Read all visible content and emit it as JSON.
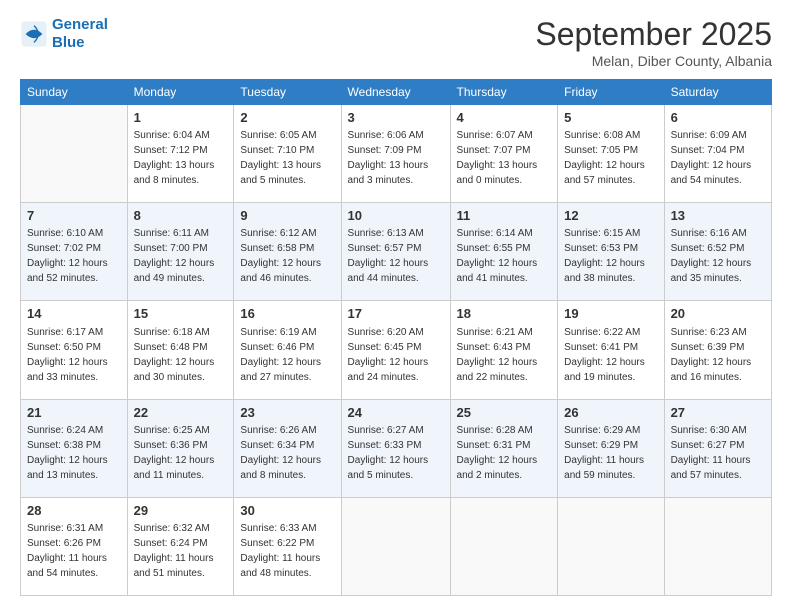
{
  "logo": {
    "line1": "General",
    "line2": "Blue"
  },
  "title": "September 2025",
  "subtitle": "Melan, Diber County, Albania",
  "headers": [
    "Sunday",
    "Monday",
    "Tuesday",
    "Wednesday",
    "Thursday",
    "Friday",
    "Saturday"
  ],
  "weeks": [
    [
      {
        "day": "",
        "sunrise": "",
        "sunset": "",
        "daylight": ""
      },
      {
        "day": "1",
        "sunrise": "Sunrise: 6:04 AM",
        "sunset": "Sunset: 7:12 PM",
        "daylight": "Daylight: 13 hours and 8 minutes."
      },
      {
        "day": "2",
        "sunrise": "Sunrise: 6:05 AM",
        "sunset": "Sunset: 7:10 PM",
        "daylight": "Daylight: 13 hours and 5 minutes."
      },
      {
        "day": "3",
        "sunrise": "Sunrise: 6:06 AM",
        "sunset": "Sunset: 7:09 PM",
        "daylight": "Daylight: 13 hours and 3 minutes."
      },
      {
        "day": "4",
        "sunrise": "Sunrise: 6:07 AM",
        "sunset": "Sunset: 7:07 PM",
        "daylight": "Daylight: 13 hours and 0 minutes."
      },
      {
        "day": "5",
        "sunrise": "Sunrise: 6:08 AM",
        "sunset": "Sunset: 7:05 PM",
        "daylight": "Daylight: 12 hours and 57 minutes."
      },
      {
        "day": "6",
        "sunrise": "Sunrise: 6:09 AM",
        "sunset": "Sunset: 7:04 PM",
        "daylight": "Daylight: 12 hours and 54 minutes."
      }
    ],
    [
      {
        "day": "7",
        "sunrise": "Sunrise: 6:10 AM",
        "sunset": "Sunset: 7:02 PM",
        "daylight": "Daylight: 12 hours and 52 minutes."
      },
      {
        "day": "8",
        "sunrise": "Sunrise: 6:11 AM",
        "sunset": "Sunset: 7:00 PM",
        "daylight": "Daylight: 12 hours and 49 minutes."
      },
      {
        "day": "9",
        "sunrise": "Sunrise: 6:12 AM",
        "sunset": "Sunset: 6:58 PM",
        "daylight": "Daylight: 12 hours and 46 minutes."
      },
      {
        "day": "10",
        "sunrise": "Sunrise: 6:13 AM",
        "sunset": "Sunset: 6:57 PM",
        "daylight": "Daylight: 12 hours and 44 minutes."
      },
      {
        "day": "11",
        "sunrise": "Sunrise: 6:14 AM",
        "sunset": "Sunset: 6:55 PM",
        "daylight": "Daylight: 12 hours and 41 minutes."
      },
      {
        "day": "12",
        "sunrise": "Sunrise: 6:15 AM",
        "sunset": "Sunset: 6:53 PM",
        "daylight": "Daylight: 12 hours and 38 minutes."
      },
      {
        "day": "13",
        "sunrise": "Sunrise: 6:16 AM",
        "sunset": "Sunset: 6:52 PM",
        "daylight": "Daylight: 12 hours and 35 minutes."
      }
    ],
    [
      {
        "day": "14",
        "sunrise": "Sunrise: 6:17 AM",
        "sunset": "Sunset: 6:50 PM",
        "daylight": "Daylight: 12 hours and 33 minutes."
      },
      {
        "day": "15",
        "sunrise": "Sunrise: 6:18 AM",
        "sunset": "Sunset: 6:48 PM",
        "daylight": "Daylight: 12 hours and 30 minutes."
      },
      {
        "day": "16",
        "sunrise": "Sunrise: 6:19 AM",
        "sunset": "Sunset: 6:46 PM",
        "daylight": "Daylight: 12 hours and 27 minutes."
      },
      {
        "day": "17",
        "sunrise": "Sunrise: 6:20 AM",
        "sunset": "Sunset: 6:45 PM",
        "daylight": "Daylight: 12 hours and 24 minutes."
      },
      {
        "day": "18",
        "sunrise": "Sunrise: 6:21 AM",
        "sunset": "Sunset: 6:43 PM",
        "daylight": "Daylight: 12 hours and 22 minutes."
      },
      {
        "day": "19",
        "sunrise": "Sunrise: 6:22 AM",
        "sunset": "Sunset: 6:41 PM",
        "daylight": "Daylight: 12 hours and 19 minutes."
      },
      {
        "day": "20",
        "sunrise": "Sunrise: 6:23 AM",
        "sunset": "Sunset: 6:39 PM",
        "daylight": "Daylight: 12 hours and 16 minutes."
      }
    ],
    [
      {
        "day": "21",
        "sunrise": "Sunrise: 6:24 AM",
        "sunset": "Sunset: 6:38 PM",
        "daylight": "Daylight: 12 hours and 13 minutes."
      },
      {
        "day": "22",
        "sunrise": "Sunrise: 6:25 AM",
        "sunset": "Sunset: 6:36 PM",
        "daylight": "Daylight: 12 hours and 11 minutes."
      },
      {
        "day": "23",
        "sunrise": "Sunrise: 6:26 AM",
        "sunset": "Sunset: 6:34 PM",
        "daylight": "Daylight: 12 hours and 8 minutes."
      },
      {
        "day": "24",
        "sunrise": "Sunrise: 6:27 AM",
        "sunset": "Sunset: 6:33 PM",
        "daylight": "Daylight: 12 hours and 5 minutes."
      },
      {
        "day": "25",
        "sunrise": "Sunrise: 6:28 AM",
        "sunset": "Sunset: 6:31 PM",
        "daylight": "Daylight: 12 hours and 2 minutes."
      },
      {
        "day": "26",
        "sunrise": "Sunrise: 6:29 AM",
        "sunset": "Sunset: 6:29 PM",
        "daylight": "Daylight: 11 hours and 59 minutes."
      },
      {
        "day": "27",
        "sunrise": "Sunrise: 6:30 AM",
        "sunset": "Sunset: 6:27 PM",
        "daylight": "Daylight: 11 hours and 57 minutes."
      }
    ],
    [
      {
        "day": "28",
        "sunrise": "Sunrise: 6:31 AM",
        "sunset": "Sunset: 6:26 PM",
        "daylight": "Daylight: 11 hours and 54 minutes."
      },
      {
        "day": "29",
        "sunrise": "Sunrise: 6:32 AM",
        "sunset": "Sunset: 6:24 PM",
        "daylight": "Daylight: 11 hours and 51 minutes."
      },
      {
        "day": "30",
        "sunrise": "Sunrise: 6:33 AM",
        "sunset": "Sunset: 6:22 PM",
        "daylight": "Daylight: 11 hours and 48 minutes."
      },
      {
        "day": "",
        "sunrise": "",
        "sunset": "",
        "daylight": ""
      },
      {
        "day": "",
        "sunrise": "",
        "sunset": "",
        "daylight": ""
      },
      {
        "day": "",
        "sunrise": "",
        "sunset": "",
        "daylight": ""
      },
      {
        "day": "",
        "sunrise": "",
        "sunset": "",
        "daylight": ""
      }
    ]
  ]
}
